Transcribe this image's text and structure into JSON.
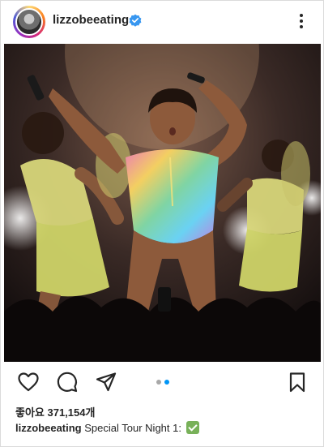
{
  "post": {
    "username": "lizzobeeating",
    "verified_icon": "verified-badge-icon",
    "more_icon": "more-vertical-icon",
    "likes_text": "좋아요 371,154개",
    "caption_user": "lizzobeeating",
    "caption_text": "Special Tour Night 1:",
    "caption_emoji": "check-mark-button-emoji"
  },
  "actions": {
    "icons": [
      "heart-icon",
      "comment-icon",
      "share-icon",
      "bookmark-icon"
    ]
  },
  "carousel": {
    "count": 2,
    "active_index": 1
  },
  "colors": {
    "text": "#262626",
    "verified": "#3897f0",
    "active_dot": "#0095f6",
    "inactive_dot": "#a8a8a8"
  }
}
